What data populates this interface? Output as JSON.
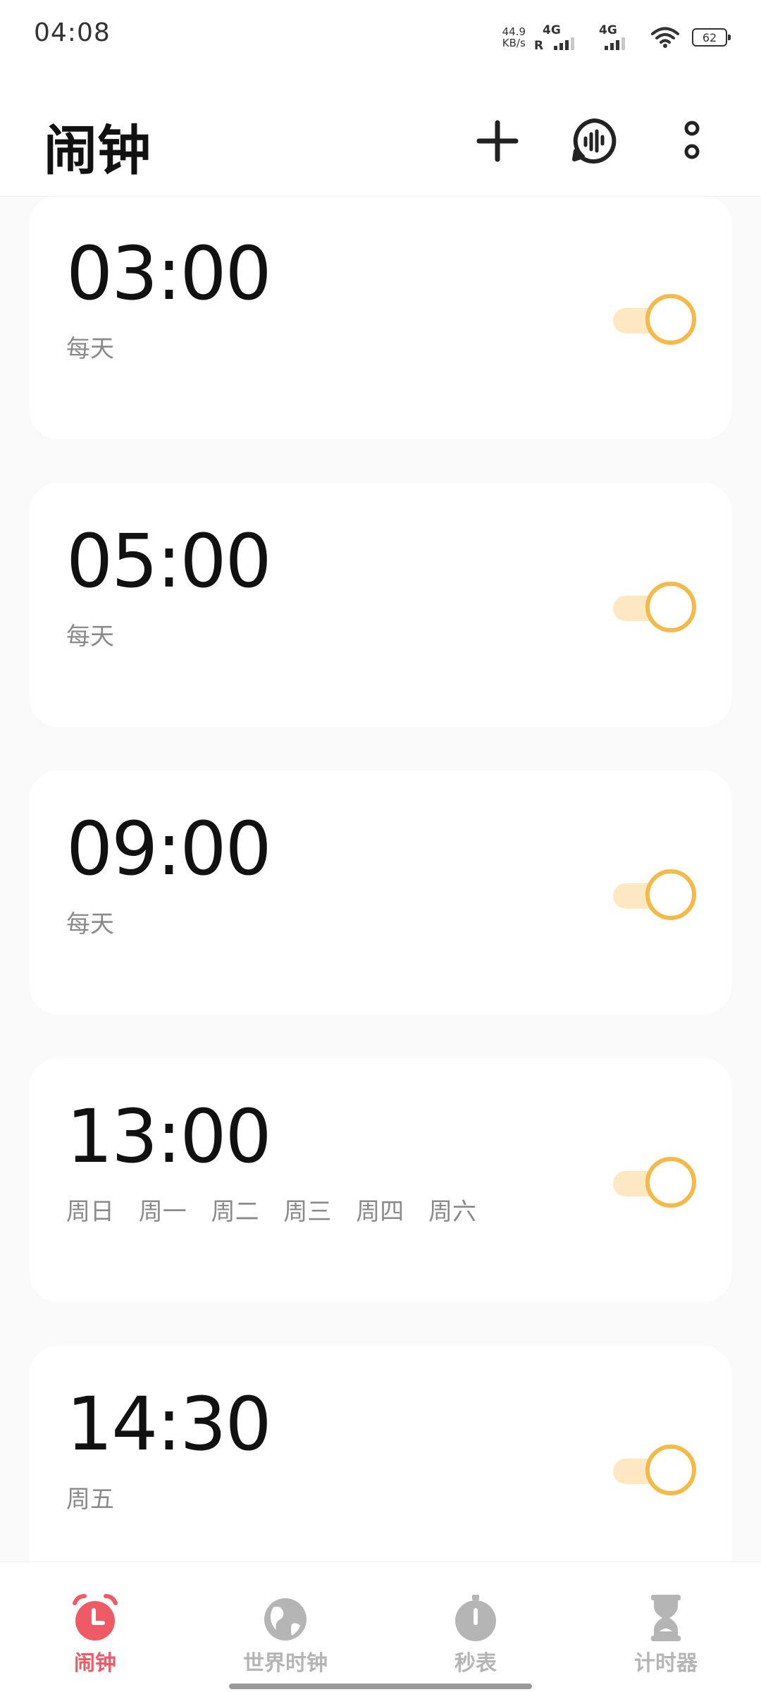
{
  "status_bar": {
    "time": "04:08",
    "net_speed_value": "44.9",
    "net_speed_unit": "KB/s",
    "roaming": "R",
    "sim1": "4G",
    "sim2": "4G",
    "battery": "62"
  },
  "header": {
    "title": "闹钟",
    "icons": [
      "add-icon",
      "voice-assistant-icon",
      "more-icon"
    ]
  },
  "alarms": [
    {
      "time": "03:00",
      "repeat": "每天",
      "enabled": true
    },
    {
      "time": "05:00",
      "repeat": "每天",
      "enabled": true
    },
    {
      "time": "09:00",
      "repeat": "每天",
      "enabled": true
    },
    {
      "time": "13:00",
      "repeat": "周日 周一 周二 周三 周四 周六",
      "enabled": true
    },
    {
      "time": "14:30",
      "repeat": "周五",
      "enabled": true
    }
  ],
  "toggle_colors": {
    "track": "#fde8c2",
    "thumb_border": "#f5b94a"
  },
  "bottom_nav": {
    "active_color": "#ee5b66",
    "inactive_color": "#b5b5b5",
    "items": [
      {
        "label": "闹钟",
        "icon": "alarm-clock-icon",
        "active": true
      },
      {
        "label": "世界时钟",
        "icon": "globe-icon",
        "active": false
      },
      {
        "label": "秒表",
        "icon": "stopwatch-icon",
        "active": false
      },
      {
        "label": "计时器",
        "icon": "hourglass-icon",
        "active": false
      }
    ]
  }
}
